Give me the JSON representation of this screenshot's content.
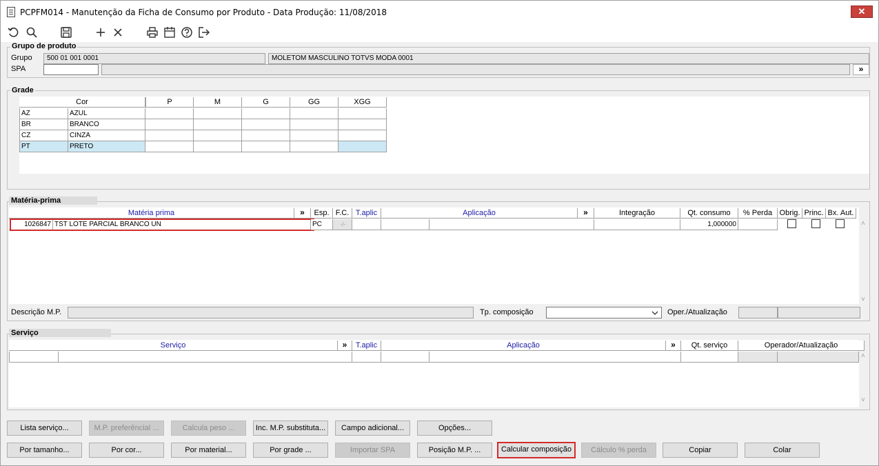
{
  "window": {
    "title": "PCPFM014 - Manutenção da Ficha de Consumo por Produto - Data Produção: 11/08/2018",
    "close": "✕"
  },
  "toolbar": {
    "icons": [
      "undo-icon",
      "search-icon",
      "save-icon",
      "add-icon",
      "delete-icon",
      "print-icon",
      "calendar-icon",
      "help-icon",
      "exit-icon"
    ]
  },
  "grupo_produto": {
    "section_label": "Grupo de produto",
    "grupo_label": "Grupo",
    "grupo_code": "500 01 001 0001",
    "grupo_desc": "MOLETOM MASCULINO TOTVS MODA 0001",
    "spa_label": "SPA",
    "spa_value": "",
    "spa_desc": "",
    "spa_button": "»"
  },
  "grade": {
    "section_label": "Grade",
    "cor_header": "Cor",
    "sizes": [
      "P",
      "M",
      "G",
      "GG",
      "XGG"
    ],
    "rows": [
      {
        "code": "AZ",
        "name": "AZUL"
      },
      {
        "code": "BR",
        "name": "BRANCO"
      },
      {
        "code": "CZ",
        "name": "CINZA"
      },
      {
        "code": "PT",
        "name": "PRETO"
      }
    ]
  },
  "materia_prima": {
    "section_label": "Matéria-prima",
    "headers": {
      "materia_prima": "Matéria prima",
      "more1": "»",
      "esp": "Esp.",
      "fc": "F.C.",
      "taplic": "T.aplic",
      "aplicacao": "Aplicação",
      "more2": "»",
      "integracao": "Integração",
      "qt_consumo": "Qt. consumo",
      "perc_perda": "% Perda",
      "obrig": "Obrig.",
      "princ": "Princ.",
      "bx_aut": "Bx. Aut."
    },
    "row": {
      "code": "1026847",
      "desc": "TST LOTE PARCIAL BRANCO UN",
      "esp": "PC",
      "fc": "-/-",
      "qt_consumo": "1,000000"
    },
    "descricao_label": "Descrição M.P.",
    "tp_composicao_label": "Tp. composição",
    "oper_label": "Oper./Atualização"
  },
  "servico": {
    "section_label": "Serviço",
    "headers": {
      "servico": "Serviço",
      "more1": "»",
      "taplic": "T.aplic",
      "aplicacao": "Aplicação",
      "more2": "»",
      "qt_servico": "Qt. serviço",
      "operador": "Operador/Atualização"
    }
  },
  "buttons": {
    "row1": [
      "Lista serviço...",
      "M.P. preferêncial ...",
      "Calcula peso ...",
      "Inc. M.P. substituta...",
      "Campo adicional...",
      "Opções..."
    ],
    "row2": [
      "Por tamanho...",
      "Por cor...",
      "Por material...",
      "Por grade ...",
      "Importar SPA",
      "Posição M.P. ...",
      "Calcular composição",
      "Cálculo % perda",
      "Copiar",
      "Colar"
    ]
  }
}
